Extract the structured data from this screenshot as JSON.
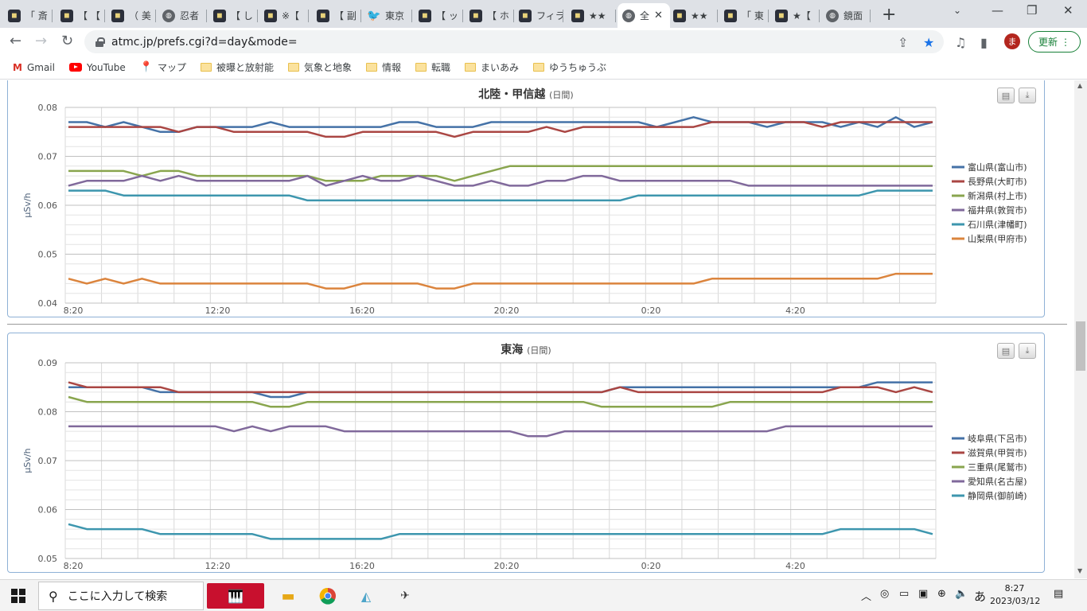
{
  "browser": {
    "tabs": [
      {
        "title": "「 斎",
        "icon": "site-icon"
      },
      {
        "title": "【 【",
        "icon": "site-icon"
      },
      {
        "title": "（ 美",
        "icon": "site-icon"
      },
      {
        "title": "忍者",
        "icon": "globe-icon"
      },
      {
        "title": "【 し",
        "icon": "site-icon"
      },
      {
        "title": "※【",
        "icon": "site-icon"
      },
      {
        "title": "【 副",
        "icon": "site-icon"
      },
      {
        "title": "東京",
        "icon": "twitter-icon"
      },
      {
        "title": "【 ッ",
        "icon": "site-icon"
      },
      {
        "title": "【 ホ",
        "icon": "site-icon"
      },
      {
        "title": "フィラ",
        "icon": "site-icon"
      },
      {
        "title": "★★",
        "icon": "site-icon"
      },
      {
        "title": "全",
        "icon": "globe-icon",
        "active": true
      },
      {
        "title": "★★",
        "icon": "site-icon"
      },
      {
        "title": "「 東",
        "icon": "site-icon"
      },
      {
        "title": "★【",
        "icon": "site-icon"
      },
      {
        "title": "鏡面",
        "icon": "globe-icon"
      }
    ],
    "url": "atmc.jp/prefs.cgi?d=day&mode=",
    "avatar_letter": "ま",
    "update_label": "更新",
    "bookmarks": [
      {
        "label": "Gmail",
        "icon": "gmail-icon"
      },
      {
        "label": "YouTube",
        "icon": "youtube-icon"
      },
      {
        "label": "マップ",
        "icon": "maps-icon"
      },
      {
        "label": "被曝と放射能",
        "icon": "folder-icon"
      },
      {
        "label": "気象と地象",
        "icon": "folder-icon"
      },
      {
        "label": "情報",
        "icon": "folder-icon"
      },
      {
        "label": "転職",
        "icon": "folder-icon"
      },
      {
        "label": "まいあみ",
        "icon": "folder-icon"
      },
      {
        "label": "ゆうちゅうぶ",
        "icon": "folder-icon"
      }
    ]
  },
  "colors": {
    "blue": "#4572a7",
    "red": "#aa4643",
    "green": "#89a54e",
    "purple": "#80699b",
    "teal": "#3d96ae",
    "orange": "#db843d"
  },
  "chart_data": [
    {
      "type": "line",
      "title": "北陸・甲信越",
      "subtitle": "(日間)",
      "ylabel": "μSv/h",
      "ylim": [
        0.04,
        0.08
      ],
      "yticks": [
        "0.08",
        "0.07",
        "0.06",
        "0.05",
        "0.04"
      ],
      "xticks": [
        "8:20",
        "12:20",
        "16:20",
        "20:20",
        "0:20",
        "4:20"
      ],
      "series": [
        {
          "name": "富山県(富山市)",
          "color": "#4572a7",
          "values": [
            0.077,
            0.077,
            0.076,
            0.077,
            0.076,
            0.075,
            0.075,
            0.076,
            0.076,
            0.076,
            0.076,
            0.077,
            0.076,
            0.076,
            0.076,
            0.076,
            0.076,
            0.076,
            0.077,
            0.077,
            0.076,
            0.076,
            0.076,
            0.077,
            0.077,
            0.077,
            0.077,
            0.077,
            0.077,
            0.077,
            0.077,
            0.077,
            0.076,
            0.077,
            0.078,
            0.077,
            0.077,
            0.077,
            0.076,
            0.077,
            0.077,
            0.077,
            0.076,
            0.077,
            0.076,
            0.078,
            0.076,
            0.077
          ]
        },
        {
          "name": "長野県(大町市)",
          "color": "#aa4643",
          "values": [
            0.076,
            0.076,
            0.076,
            0.076,
            0.076,
            0.076,
            0.075,
            0.076,
            0.076,
            0.075,
            0.075,
            0.075,
            0.075,
            0.075,
            0.074,
            0.074,
            0.075,
            0.075,
            0.075,
            0.075,
            0.075,
            0.074,
            0.075,
            0.075,
            0.075,
            0.075,
            0.076,
            0.075,
            0.076,
            0.076,
            0.076,
            0.076,
            0.076,
            0.076,
            0.076,
            0.077,
            0.077,
            0.077,
            0.077,
            0.077,
            0.077,
            0.076,
            0.077,
            0.077,
            0.077,
            0.077,
            0.077,
            0.077
          ]
        },
        {
          "name": "新潟県(村上市)",
          "color": "#89a54e",
          "values": [
            0.067,
            0.067,
            0.067,
            0.067,
            0.066,
            0.067,
            0.067,
            0.066,
            0.066,
            0.066,
            0.066,
            0.066,
            0.066,
            0.066,
            0.065,
            0.065,
            0.065,
            0.066,
            0.066,
            0.066,
            0.066,
            0.065,
            0.066,
            0.067,
            0.068,
            0.068,
            0.068,
            0.068,
            0.068,
            0.068,
            0.068,
            0.068,
            0.068,
            0.068,
            0.068,
            0.068,
            0.068,
            0.068,
            0.068,
            0.068,
            0.068,
            0.068,
            0.068,
            0.068,
            0.068,
            0.068,
            0.068,
            0.068
          ]
        },
        {
          "name": "福井県(敦賀市)",
          "color": "#80699b",
          "values": [
            0.064,
            0.065,
            0.065,
            0.065,
            0.066,
            0.065,
            0.066,
            0.065,
            0.065,
            0.065,
            0.065,
            0.065,
            0.065,
            0.066,
            0.064,
            0.065,
            0.066,
            0.065,
            0.065,
            0.066,
            0.065,
            0.064,
            0.064,
            0.065,
            0.064,
            0.064,
            0.065,
            0.065,
            0.066,
            0.066,
            0.065,
            0.065,
            0.065,
            0.065,
            0.065,
            0.065,
            0.065,
            0.064,
            0.064,
            0.064,
            0.064,
            0.064,
            0.064,
            0.064,
            0.064,
            0.064,
            0.064,
            0.064
          ]
        },
        {
          "name": "石川県(津幡町)",
          "color": "#3d96ae",
          "values": [
            0.063,
            0.063,
            0.063,
            0.062,
            0.062,
            0.062,
            0.062,
            0.062,
            0.062,
            0.062,
            0.062,
            0.062,
            0.062,
            0.061,
            0.061,
            0.061,
            0.061,
            0.061,
            0.061,
            0.061,
            0.061,
            0.061,
            0.061,
            0.061,
            0.061,
            0.061,
            0.061,
            0.061,
            0.061,
            0.061,
            0.061,
            0.062,
            0.062,
            0.062,
            0.062,
            0.062,
            0.062,
            0.062,
            0.062,
            0.062,
            0.062,
            0.062,
            0.062,
            0.062,
            0.063,
            0.063,
            0.063,
            0.063
          ]
        },
        {
          "name": "山梨県(甲府市)",
          "color": "#db843d",
          "values": [
            0.045,
            0.044,
            0.045,
            0.044,
            0.045,
            0.044,
            0.044,
            0.044,
            0.044,
            0.044,
            0.044,
            0.044,
            0.044,
            0.044,
            0.043,
            0.043,
            0.044,
            0.044,
            0.044,
            0.044,
            0.043,
            0.043,
            0.044,
            0.044,
            0.044,
            0.044,
            0.044,
            0.044,
            0.044,
            0.044,
            0.044,
            0.044,
            0.044,
            0.044,
            0.044,
            0.045,
            0.045,
            0.045,
            0.045,
            0.045,
            0.045,
            0.045,
            0.045,
            0.045,
            0.045,
            0.046,
            0.046,
            0.046
          ]
        }
      ]
    },
    {
      "type": "line",
      "title": "東海",
      "subtitle": "(日間)",
      "ylabel": "μSv/h",
      "ylim": [
        0.05,
        0.09
      ],
      "yticks": [
        "0.09",
        "0.08",
        "0.07",
        "0.06",
        "0.05"
      ],
      "xticks": [
        "8:20",
        "12:20",
        "16:20",
        "20:20",
        "0:20",
        "4:20"
      ],
      "series": [
        {
          "name": "岐阜県(下呂市)",
          "color": "#4572a7",
          "values": [
            0.085,
            0.085,
            0.085,
            0.085,
            0.085,
            0.084,
            0.084,
            0.084,
            0.084,
            0.084,
            0.084,
            0.083,
            0.083,
            0.084,
            0.084,
            0.084,
            0.084,
            0.084,
            0.084,
            0.084,
            0.084,
            0.084,
            0.084,
            0.084,
            0.084,
            0.084,
            0.084,
            0.084,
            0.084,
            0.084,
            0.085,
            0.085,
            0.085,
            0.085,
            0.085,
            0.085,
            0.085,
            0.085,
            0.085,
            0.085,
            0.085,
            0.085,
            0.085,
            0.085,
            0.086,
            0.086,
            0.086,
            0.086
          ]
        },
        {
          "name": "滋賀県(甲賀市)",
          "color": "#aa4643",
          "values": [
            0.086,
            0.085,
            0.085,
            0.085,
            0.085,
            0.085,
            0.084,
            0.084,
            0.084,
            0.084,
            0.084,
            0.084,
            0.084,
            0.084,
            0.084,
            0.084,
            0.084,
            0.084,
            0.084,
            0.084,
            0.084,
            0.084,
            0.084,
            0.084,
            0.084,
            0.084,
            0.084,
            0.084,
            0.084,
            0.084,
            0.085,
            0.084,
            0.084,
            0.084,
            0.084,
            0.084,
            0.084,
            0.084,
            0.084,
            0.084,
            0.084,
            0.084,
            0.085,
            0.085,
            0.085,
            0.084,
            0.085,
            0.084
          ]
        },
        {
          "name": "三重県(尾鷲市)",
          "color": "#89a54e",
          "values": [
            0.083,
            0.082,
            0.082,
            0.082,
            0.082,
            0.082,
            0.082,
            0.082,
            0.082,
            0.082,
            0.082,
            0.081,
            0.081,
            0.082,
            0.082,
            0.082,
            0.082,
            0.082,
            0.082,
            0.082,
            0.082,
            0.082,
            0.082,
            0.082,
            0.082,
            0.082,
            0.082,
            0.082,
            0.082,
            0.081,
            0.081,
            0.081,
            0.081,
            0.081,
            0.081,
            0.081,
            0.082,
            0.082,
            0.082,
            0.082,
            0.082,
            0.082,
            0.082,
            0.082,
            0.082,
            0.082,
            0.082,
            0.082
          ]
        },
        {
          "name": "愛知県(名古屋)",
          "color": "#80699b",
          "values": [
            0.077,
            0.077,
            0.077,
            0.077,
            0.077,
            0.077,
            0.077,
            0.077,
            0.077,
            0.076,
            0.077,
            0.076,
            0.077,
            0.077,
            0.077,
            0.076,
            0.076,
            0.076,
            0.076,
            0.076,
            0.076,
            0.076,
            0.076,
            0.076,
            0.076,
            0.075,
            0.075,
            0.076,
            0.076,
            0.076,
            0.076,
            0.076,
            0.076,
            0.076,
            0.076,
            0.076,
            0.076,
            0.076,
            0.076,
            0.077,
            0.077,
            0.077,
            0.077,
            0.077,
            0.077,
            0.077,
            0.077,
            0.077
          ]
        },
        {
          "name": "静岡県(御前崎)",
          "color": "#3d96ae",
          "values": [
            0.057,
            0.056,
            0.056,
            0.056,
            0.056,
            0.055,
            0.055,
            0.055,
            0.055,
            0.055,
            0.055,
            0.054,
            0.054,
            0.054,
            0.054,
            0.054,
            0.054,
            0.054,
            0.055,
            0.055,
            0.055,
            0.055,
            0.055,
            0.055,
            0.055,
            0.055,
            0.055,
            0.055,
            0.055,
            0.055,
            0.055,
            0.055,
            0.055,
            0.055,
            0.055,
            0.055,
            0.055,
            0.055,
            0.055,
            0.055,
            0.055,
            0.055,
            0.056,
            0.056,
            0.056,
            0.056,
            0.056,
            0.055
          ]
        }
      ]
    }
  ],
  "taskbar": {
    "search_placeholder": "ここに入力して検索",
    "ime": "あ",
    "time": "8:27",
    "date": "2023/03/12"
  }
}
